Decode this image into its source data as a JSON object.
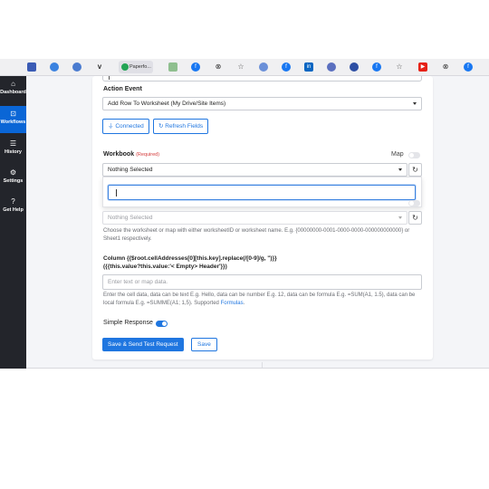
{
  "bookmarks": {
    "papers_tab": "Paperfo..."
  },
  "sidebar": {
    "items": [
      {
        "label": "Dashboard",
        "icon": "home-icon"
      },
      {
        "label": "Workflows",
        "icon": "workflow-icon"
      },
      {
        "label": "History",
        "icon": "list-icon"
      },
      {
        "label": "Settings",
        "icon": "gear-icon"
      },
      {
        "label": "Get Help",
        "icon": "help-icon"
      }
    ]
  },
  "form": {
    "action_event_label": "Action Event",
    "action_event_value": "Add Row To Worksheet (My Drive/Site Items)",
    "connected_label": "Connected",
    "refresh_fields_label": "Refresh Fields",
    "workbook_label": "Workbook",
    "workbook_required": "(Required)",
    "map_label": "Map",
    "workbook_value": "Nothing Selected",
    "worksheet_value": "Nothing Selected",
    "worksheet_help": "Choose the worksheet or map with either worksheetID or worksheet name. E.g. {00000000-0001-0000-0000-000000000000} or Sheet1 respectively.",
    "column_label_line1": "Column {{$root.cellAddresses[0][this.key].replace(/[0-9]/g, '')}}",
    "column_label_line2": "({{this.value?this.value:'< Empty> Header'}})",
    "column_placeholder": "Enter text or map data.",
    "column_help": "Enter the cell data, data can be text E.g. Hello, data can be number E.g. 12, data can be formula E.g. =SUM(A1, 1.5), data can be local formula E.g. =SUMME(A1; 1,5). Supported",
    "column_help_link": "Formulas",
    "simple_response_label": "Simple Response",
    "send_test_label": "Save & Send Test Request",
    "save_label": "Save"
  },
  "colors": {
    "accent": "#1f76e0",
    "sidebar_bg": "#23252b",
    "sidebar_active": "#0a66d6",
    "required": "#d43b3b"
  }
}
